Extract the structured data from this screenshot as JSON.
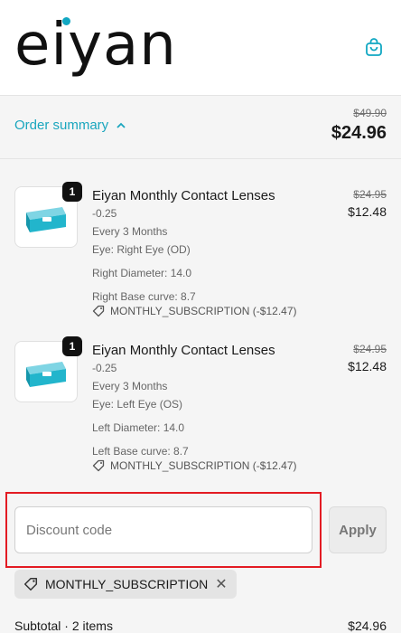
{
  "header": {
    "logo_text": "eiyan",
    "bag_icon": "shopping-bag-icon",
    "accent": "#11a7c2"
  },
  "summary": {
    "toggle_label": "Order summary",
    "toggle_icon": "chevron-up-icon",
    "original_total": "$49.90",
    "total": "$24.96"
  },
  "items": [
    {
      "quantity": "1",
      "name": "Eiyan Monthly Contact Lenses",
      "power": "-0.25",
      "frequency": "Every 3 Months",
      "eye": "Eye: Right Eye (OD)",
      "diameter": "Right Diameter: 14.0",
      "base_curve": "Right Base curve: 8.7",
      "discount": "MONTHLY_SUBSCRIPTION (-$12.47)",
      "original_price": "$24.95",
      "price": "$12.48"
    },
    {
      "quantity": "1",
      "name": "Eiyan Monthly Contact Lenses",
      "power": "-0.25",
      "frequency": "Every 3 Months",
      "eye": "Eye: Left Eye (OS)",
      "diameter": "Left Diameter: 14.0",
      "base_curve": "Left Base curve: 8.7",
      "discount": "MONTHLY_SUBSCRIPTION (-$12.47)",
      "original_price": "$24.95",
      "price": "$12.48"
    }
  ],
  "discount": {
    "placeholder": "Discount code",
    "value": "",
    "apply_label": "Apply",
    "applied_code": "MONTHLY_SUBSCRIPTION",
    "highlight_color": "#e31b23"
  },
  "subtotal": {
    "label": "Subtotal · 2 items",
    "value": "$24.96"
  }
}
